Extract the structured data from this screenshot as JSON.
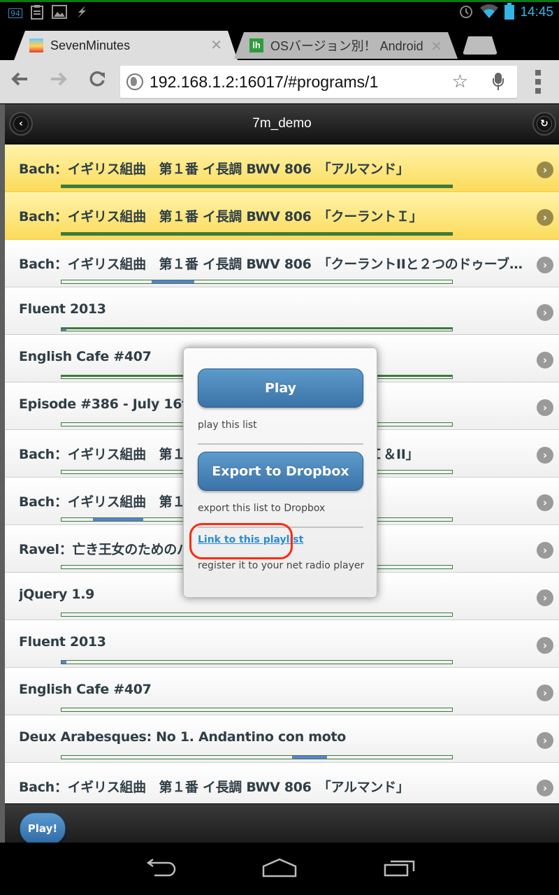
{
  "status_bar": {
    "notification_badge": "94",
    "battery_percent_small": "94%",
    "time": "14:45",
    "icons": [
      "notes-icon",
      "image-icon",
      "flash-icon",
      "alarm-icon",
      "wifi-icon",
      "battery-icon"
    ]
  },
  "browser": {
    "tabs": [
      {
        "title": "SevenMinutes",
        "favicon": "seven-minutes-favicon",
        "active": true
      },
      {
        "title": "OSバージョン別！ Android",
        "favicon": "lh-favicon",
        "active": false
      }
    ],
    "url": "192.168.1.2:16017/#programs/1",
    "nav": {
      "back": "back-icon",
      "forward": "forward-icon",
      "reload": "reload-icon"
    }
  },
  "header": {
    "title": "7m_demo",
    "left_icon": "back-circle-icon",
    "right_icon": "refresh-circle-icon"
  },
  "list": {
    "items": [
      {
        "title": "Bach：イギリス組曲　第１番 イ長調 BWV 806　「アルマンド」",
        "active": true,
        "progress_fraction": 1.0,
        "marker": null
      },
      {
        "title": "Bach：イギリス組曲　第１番 イ長調 BWV 806　「クーラントＩ」",
        "active": true,
        "progress_fraction": 1.0,
        "marker": null
      },
      {
        "title": "Bach：イギリス組曲　第１番 イ長調 BWV 806　「クーラントIIと２つのドゥーブル」",
        "active": false,
        "marker": {
          "start": 0.23,
          "end": 0.34
        }
      },
      {
        "title": "Fluent 2013",
        "active": true,
        "progress_fraction": 1.0,
        "marker": {
          "start": 0.0,
          "end": 0.01
        }
      },
      {
        "title": "English Cafe #407",
        "active": true,
        "progress_fraction": 1.0,
        "marker": null
      },
      {
        "title": "Episode #386 - July 16th",
        "active": false,
        "marker": null
      },
      {
        "title": "Bach：イギリス組曲　第１番 イ長調 BWV 806　「ブーレＩ＆II」",
        "active": false,
        "marker": null
      },
      {
        "title": "Bach：イギリス組曲　第１番 イ長調 BWV 806　「ジーグ」",
        "active": false,
        "marker": {
          "start": 0.08,
          "end": 0.21
        }
      },
      {
        "title": "Ravel：亡き王女のためのパヴァーヌ",
        "active": false,
        "marker": null
      },
      {
        "title": "jQuery 1.9",
        "active": false,
        "marker": null
      },
      {
        "title": "Fluent 2013",
        "active": false,
        "marker": {
          "start": 0.0,
          "end": 0.01
        }
      },
      {
        "title": "English Cafe #407",
        "active": false,
        "marker": null
      },
      {
        "title": "Deux Arabesques: No 1. Andantino con moto",
        "active": false,
        "marker": {
          "start": 0.59,
          "end": 0.68
        }
      },
      {
        "title": "Bach：イギリス組曲　第１番 イ長調 BWV 806　「アルマンド」",
        "active": false,
        "marker": null
      }
    ]
  },
  "popup": {
    "play_label": "Play",
    "play_desc": "play this list",
    "export_label": "Export to Dropbox",
    "export_desc": "export this list to Dropbox",
    "link_label": "Link to this playlist",
    "link_desc": "register it to your net radio player",
    "highlight_color": "#ff2a10"
  },
  "footer": {
    "play_label": "Play!"
  },
  "navbar": {
    "buttons": [
      "back-nav-icon",
      "home-nav-icon",
      "recents-nav-icon"
    ]
  },
  "colors": {
    "accent_blue": "#3b73a8",
    "active_row": "#fbdb5a",
    "progress_border": "#3d7a3d",
    "marker_blue": "#5b7fd6",
    "clock": "#33b5e5"
  }
}
